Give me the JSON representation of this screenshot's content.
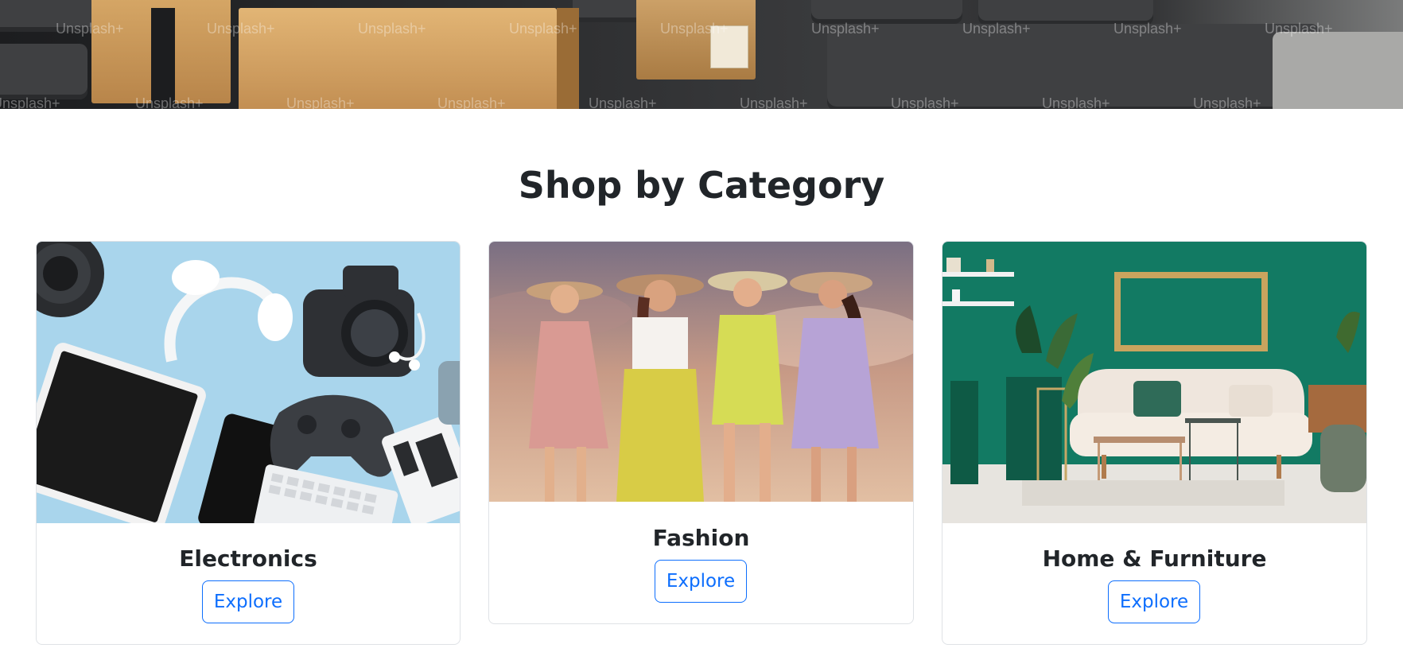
{
  "hero": {
    "watermark": "Unsplash+"
  },
  "section": {
    "title": "Shop by Category"
  },
  "categories": [
    {
      "title": "Electronics",
      "button": "Explore",
      "image": "electronics-flatlay-image"
    },
    {
      "title": "Fashion",
      "button": "Explore",
      "image": "fashion-women-in-hats-image"
    },
    {
      "title": "Home & Furniture",
      "button": "Explore",
      "image": "green-living-room-image"
    }
  ],
  "colors": {
    "primary": "#0d6efd",
    "text": "#212529",
    "border": "#dfe2e6"
  }
}
